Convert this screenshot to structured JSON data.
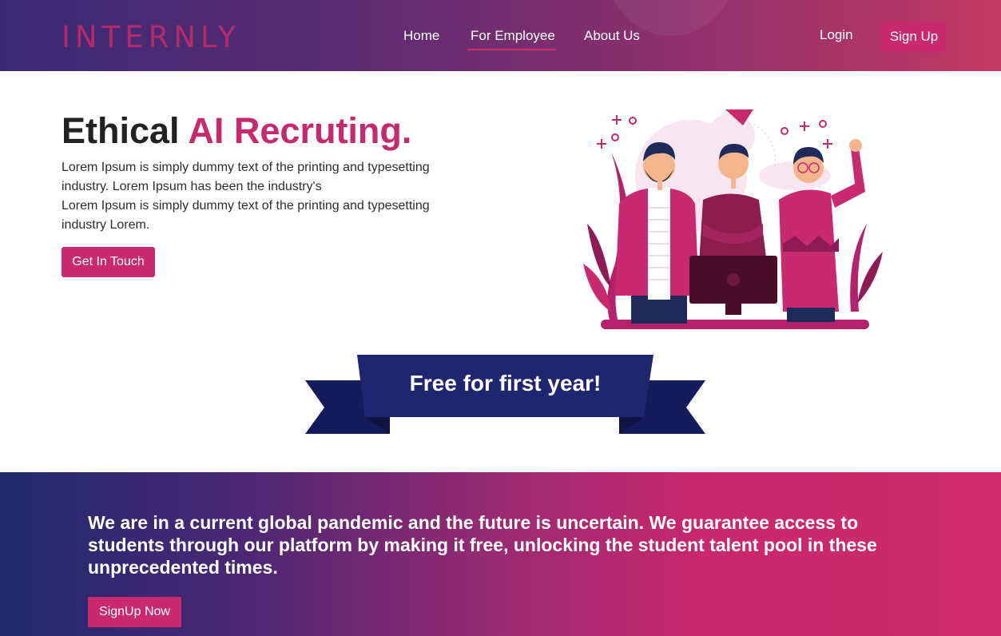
{
  "nav": {
    "logo": "INTERNLY",
    "links": [
      {
        "label": "Home"
      },
      {
        "label": "For Employee",
        "active": true
      },
      {
        "label": "About Us"
      }
    ],
    "login": "Login",
    "signup": "Sign Up"
  },
  "hero": {
    "title_part1": "Ethical",
    "title_part2": "AI Recruting.",
    "paragraph_line1": "Lorem Ipsum is simply dummy text of the printing and typesetting industry. Lorem Ipsum has been the industry's",
    "paragraph_line2": "Lorem Ipsum is simply dummy text of the printing and typesetting industry Lorem.",
    "cta": "Get In Touch"
  },
  "ribbon": {
    "text": "Free for first year!"
  },
  "banner": {
    "text": "We are in a current global pandemic and the future is uncertain. We guarantee access to students through our platform by making it free, unlocking the student talent pool in these unprecedented times.",
    "cta": "SignUp Now"
  },
  "colors": {
    "accent": "#c8296f",
    "ribbon": "#1f2670",
    "ribbon_dark": "#141c5c"
  }
}
